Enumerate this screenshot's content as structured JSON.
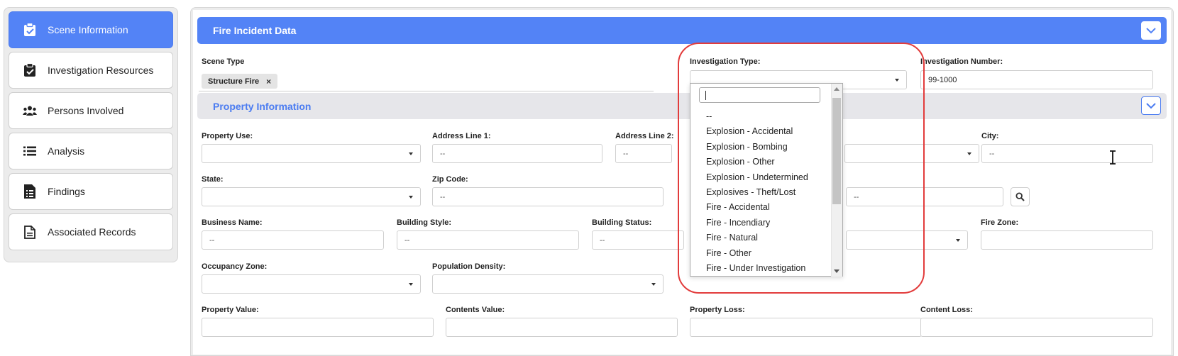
{
  "sidebar": {
    "items": [
      {
        "label": "Scene Information",
        "icon": "clipboard-check-icon",
        "active": true
      },
      {
        "label": "Investigation Resources",
        "icon": "clipboard-check-icon",
        "active": false
      },
      {
        "label": "Persons Involved",
        "icon": "users-icon",
        "active": false
      },
      {
        "label": "Analysis",
        "icon": "list-icon",
        "active": false
      },
      {
        "label": "Findings",
        "icon": "file-list-icon",
        "active": false
      },
      {
        "label": "Associated Records",
        "icon": "file-icon",
        "active": false
      }
    ]
  },
  "fire_incident": {
    "title": "Fire Incident Data",
    "scene_type_label": "Scene Type",
    "scene_type_value": "Structure Fire",
    "chip_remove": "×",
    "investigation_type_label": "Investigation Type:",
    "investigation_type_value": "",
    "investigation_number_label": "Investigation Number:",
    "investigation_number_value": "99-1000"
  },
  "property": {
    "title": "Property Information",
    "property_use_label": "Property Use:",
    "address1_label": "Address Line 1:",
    "address1_placeholder": "--",
    "address2_label": "Address Line 2:",
    "address2_placeholder": "--",
    "city_label": "City:",
    "city_placeholder": "--",
    "state_label": "State:",
    "zip_label": "Zip Code:",
    "zip_placeholder": "--",
    "lookup_placeholder": "--",
    "business_name_label": "Business Name:",
    "business_name_placeholder": "--",
    "building_style_label": "Building Style:",
    "building_style_placeholder": "--",
    "building_status_label": "Building Status:",
    "building_status_placeholder": "--",
    "fire_zone_label": "Fire Zone:",
    "occupancy_zone_label": "Occupancy Zone:",
    "population_density_label": "Population Density:",
    "property_value_label": "Property Value:",
    "contents_value_label": "Contents Value:",
    "property_loss_label": "Property Loss:",
    "content_loss_label": "Content Loss:"
  },
  "dropdown": {
    "search_value": "",
    "options": [
      "--",
      "Explosion - Accidental",
      "Explosion - Bombing",
      "Explosion - Other",
      "Explosion - Undetermined",
      "Explosives - Theft/Lost",
      "Fire - Accidental",
      "Fire - Incendiary",
      "Fire - Natural",
      "Fire - Other",
      "Fire - Under Investigation"
    ]
  },
  "colors": {
    "accent": "#5383f6",
    "highlight": "#e23c3c",
    "section_bar": "#e6e6ea"
  }
}
